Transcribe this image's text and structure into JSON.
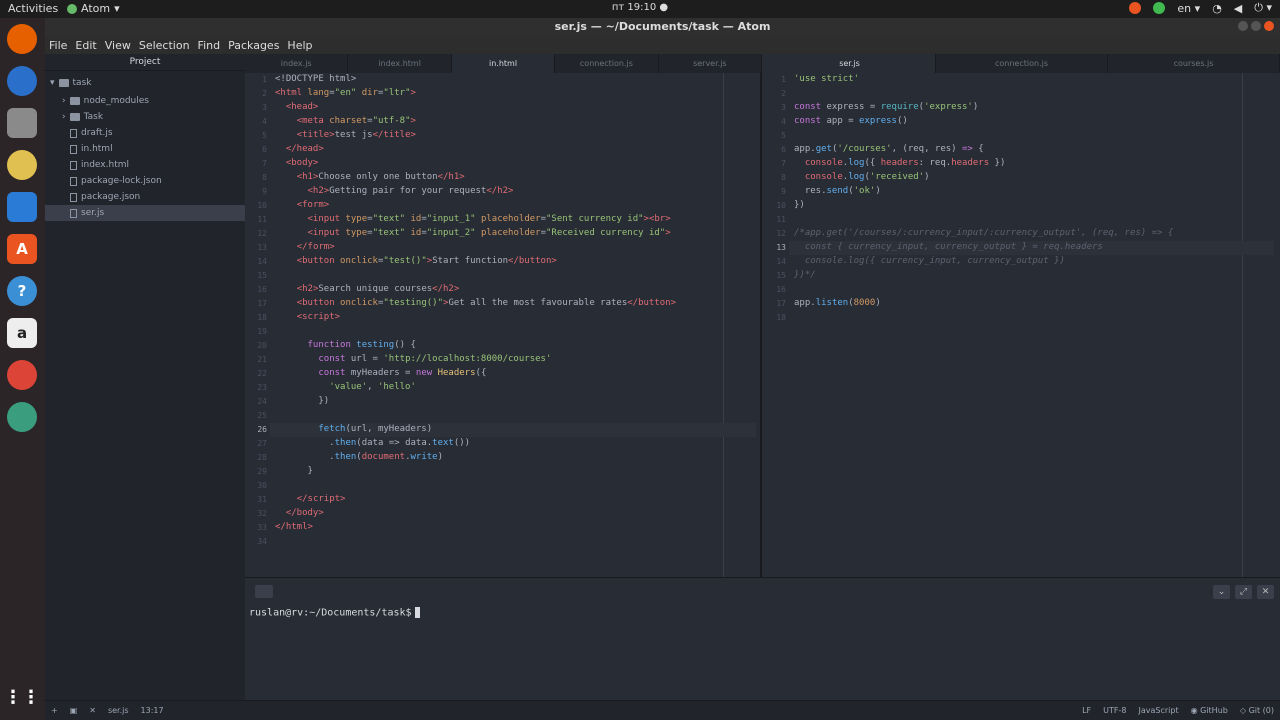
{
  "topbar": {
    "activities": "Activities",
    "app": "Atom",
    "clock": "пт 19:10 ●",
    "lang": "en"
  },
  "window": {
    "title": "ser.js — ~/Documents/task — Atom"
  },
  "menu": [
    "File",
    "Edit",
    "View",
    "Selection",
    "Find",
    "Packages",
    "Help"
  ],
  "tree": {
    "header": "Project",
    "root": "task",
    "folders": [
      "node_modules",
      "Task"
    ],
    "files": [
      "draft.js",
      "in.html",
      "index.html",
      "package-lock.json",
      "package.json",
      "ser.js"
    ]
  },
  "left_tabs": [
    "index.js",
    "index.html",
    "in.html",
    "connection.js",
    "server.js"
  ],
  "right_tabs": [
    "ser.js",
    "connection.js",
    "courses.js"
  ],
  "terminal": {
    "prompt": "ruslan@rv:~/Documents/task$"
  },
  "status": {
    "file": "ser.js",
    "pos": "13:17",
    "eol": "LF",
    "enc": "UTF-8",
    "grammar": "JavaScript",
    "github": "GitHub",
    "git": "Git (0)"
  }
}
